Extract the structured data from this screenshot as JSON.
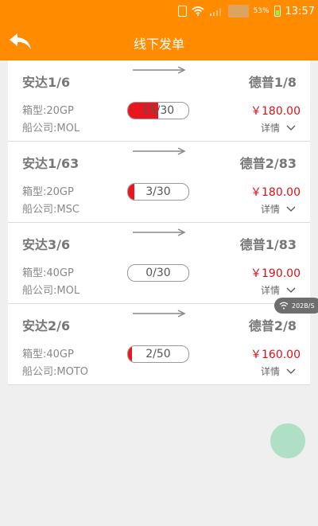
{
  "status_bar": {
    "battery_percent": "53%",
    "time": "13:57"
  },
  "header": {
    "title": "线下发单"
  },
  "speed_badge": "202B/S",
  "colors": {
    "accent": "#ff8c00",
    "price": "#e0101a",
    "progress_fill": "#e8161e",
    "fab": "#a7ddbf"
  },
  "orders": [
    {
      "origin": "安达1/6",
      "destination": "德普1/8",
      "box_type": "箱型:20GP",
      "carrier": "船公司:MOL",
      "progress_text": "15/30",
      "progress_fraction": 0.5,
      "price": "￥180.00",
      "detail_label": "详情"
    },
    {
      "origin": "安达1/63",
      "destination": "德普2/83",
      "box_type": "箱型:20GP",
      "carrier": "船公司:MSC",
      "progress_text": "3/30",
      "progress_fraction": 0.1,
      "price": "￥180.00",
      "detail_label": "详情"
    },
    {
      "origin": "安达3/6",
      "destination": "德普1/83",
      "box_type": "箱型:40GP",
      "carrier": "船公司:MOL",
      "progress_text": "0/30",
      "progress_fraction": 0,
      "price": "￥190.00",
      "detail_label": "详情"
    },
    {
      "origin": "安达2/6",
      "destination": "德普2/8",
      "box_type": "箱型:40GP",
      "carrier": "船公司:MOTO",
      "progress_text": "2/50",
      "progress_fraction": 0.04,
      "price": "￥160.00",
      "detail_label": "详情"
    }
  ]
}
